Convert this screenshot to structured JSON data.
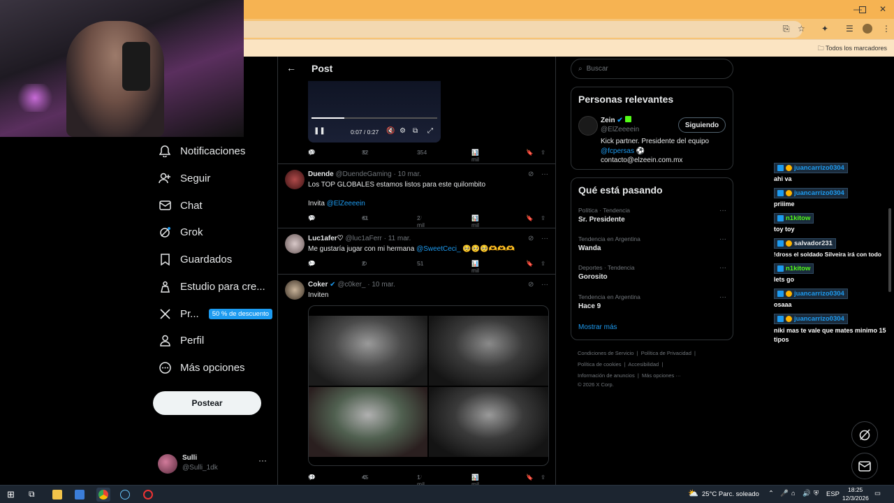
{
  "browser": {
    "bookmarks_label": "Todos los marcadores"
  },
  "nav": {
    "items": [
      {
        "label": "Notificaciones",
        "icon": "bell-icon"
      },
      {
        "label": "Seguir",
        "icon": "person-plus-icon"
      },
      {
        "label": "Chat",
        "icon": "envelope-icon"
      },
      {
        "label": "Grok",
        "icon": "grok-icon"
      },
      {
        "label": "Guardados",
        "icon": "bookmark-icon"
      },
      {
        "label": "Estudio para cre...",
        "icon": "creator-studio-icon"
      },
      {
        "label": "Pr...",
        "icon": "x-logo-icon"
      },
      {
        "label": "Perfil",
        "icon": "profile-icon"
      },
      {
        "label": "Más opciones",
        "icon": "more-options-icon"
      }
    ],
    "promo_badge": "50 % de descuento",
    "post_button": "Postear",
    "user": {
      "name": "Sulli",
      "handle": "@Sulli_1dk"
    }
  },
  "main": {
    "header_title": "Post",
    "video": {
      "time": "0:07 / 0:27"
    },
    "tweets": [
      {
        "name": "",
        "handle": "",
        "date": "",
        "text": "",
        "replies": "30",
        "reposts": "32",
        "likes": "354",
        "views": "13 mil"
      },
      {
        "name": "Duende",
        "handle": "@DuendeGaming",
        "date": "· 10 mar.",
        "text": "Los TOP GLOBALES estamos listos para este quilombito",
        "text2": "Invita",
        "mention": "@ElZeeeein",
        "replies": "73",
        "reposts": "61",
        "likes": "2 mil",
        "views": "43 mil"
      },
      {
        "name": "Luc1afer♡",
        "handle": "@luc1aFerr",
        "date": "· 11 mar.",
        "text": "Me gustaría jugar con mi hermana",
        "mention": "@SweetCeci_",
        "emojis": "🥺🥺🥺🫶🫶🫶",
        "replies": "2",
        "reposts": "2",
        "likes": "51",
        "views": "1 mil"
      },
      {
        "name": "Coker",
        "handle": "@c0ker_",
        "date": "· 10 mar.",
        "text": "Inviten",
        "replies": "11",
        "reposts": "45",
        "likes": "1 mil",
        "views": "33 mil"
      }
    ]
  },
  "right": {
    "search_placeholder": "Buscar",
    "relevant": {
      "title": "Personas relevantes",
      "name": "Zein",
      "handle": "@ElZeeeein",
      "follow_label": "Siguiendo",
      "bio1": "Kick partner. Presidente del equipo",
      "bio_mention": "@fcpersas",
      "bio2": "contacto@elzeein.com.mx"
    },
    "trends": {
      "title": "Qué está pasando",
      "items": [
        {
          "category": "Política · Tendencia",
          "name": "Sr. Presidente"
        },
        {
          "category": "Tendencia en Argentina",
          "name": "Wanda"
        },
        {
          "category": "Deportes · Tendencia",
          "name": "Gorosito"
        },
        {
          "category": "Tendencia en Argentina",
          "name": "Hace 9"
        }
      ],
      "show_more": "Mostrar más"
    },
    "footer": {
      "terms": "Condiciones de Servicio",
      "privacy": "Política de Privacidad",
      "cookies": "Política de cookies",
      "accessibility": "Accesibilidad",
      "ads": "Información de anuncios",
      "more": "Más opciones ···",
      "copyright": "© 2026 X Corp."
    }
  },
  "chat": [
    {
      "user": "juancarrizo0304",
      "msg": "ahi va"
    },
    {
      "user": "juancarrizo0304",
      "msg": "priiime"
    },
    {
      "user": "n1kitow",
      "msg": "toy toy"
    },
    {
      "user": "salvador231",
      "msg": "!dross el soldado Silveira irá con todo"
    },
    {
      "user": "n1kitow",
      "msg": "lets go"
    },
    {
      "user": "juancarrizo0304",
      "msg": "osaaa"
    },
    {
      "user": "juancarrizo0304",
      "msg": "niki mas te vale que mates minimo 15 tipos"
    }
  ],
  "taskbar": {
    "weather": "25°C  Parc. soleado",
    "lang": "ESP",
    "time": "18:25",
    "date": "12/3/2026"
  },
  "colors": {
    "accent": "#1d9bf0",
    "chrome": "#f6b352",
    "background": "#000000"
  }
}
